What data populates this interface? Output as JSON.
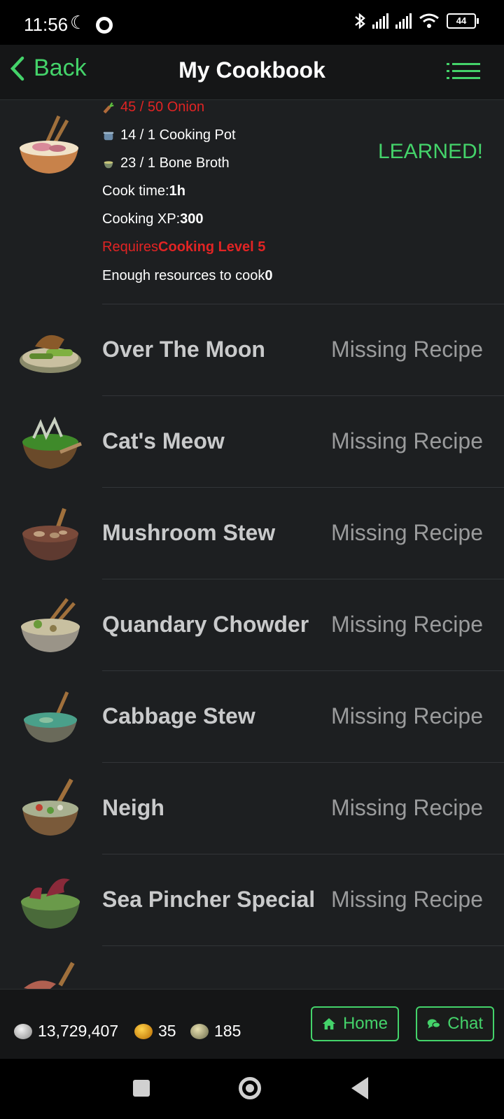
{
  "status_bar": {
    "time": "11:56",
    "battery": "44"
  },
  "header": {
    "back_label": "Back",
    "title": "My Cookbook"
  },
  "expanded_recipe": {
    "requirements": [
      {
        "text": "45 / 50 Onion",
        "insufficient": true
      },
      {
        "text": "14 / 1 Cooking Pot",
        "insufficient": false
      },
      {
        "text": "23 / 1 Bone Broth",
        "insufficient": false
      }
    ],
    "cook_time_label": "Cook time: ",
    "cook_time_value": "1h",
    "xp_label": "Cooking XP: ",
    "xp_value": "300",
    "requires_label": "Requires ",
    "requires_value": "Cooking Level 5",
    "enough_label": "Enough resources to cook ",
    "enough_value": "0",
    "status": "LEARNED!"
  },
  "recipes": [
    {
      "name": "Over The Moon",
      "status": "Missing Recipe"
    },
    {
      "name": "Cat's Meow",
      "status": "Missing Recipe"
    },
    {
      "name": "Mushroom Stew",
      "status": "Missing Recipe"
    },
    {
      "name": "Quandary Chowder",
      "status": "Missing Recipe"
    },
    {
      "name": "Cabbage Stew",
      "status": "Missing Recipe"
    },
    {
      "name": "Neigh",
      "status": "Missing Recipe"
    },
    {
      "name": "Sea Pincher Special",
      "status": "Missing Recipe"
    }
  ],
  "footer": {
    "silver": "13,729,407",
    "gold": "35",
    "tokens": "185",
    "home_label": "Home",
    "chat_label": "Chat"
  }
}
